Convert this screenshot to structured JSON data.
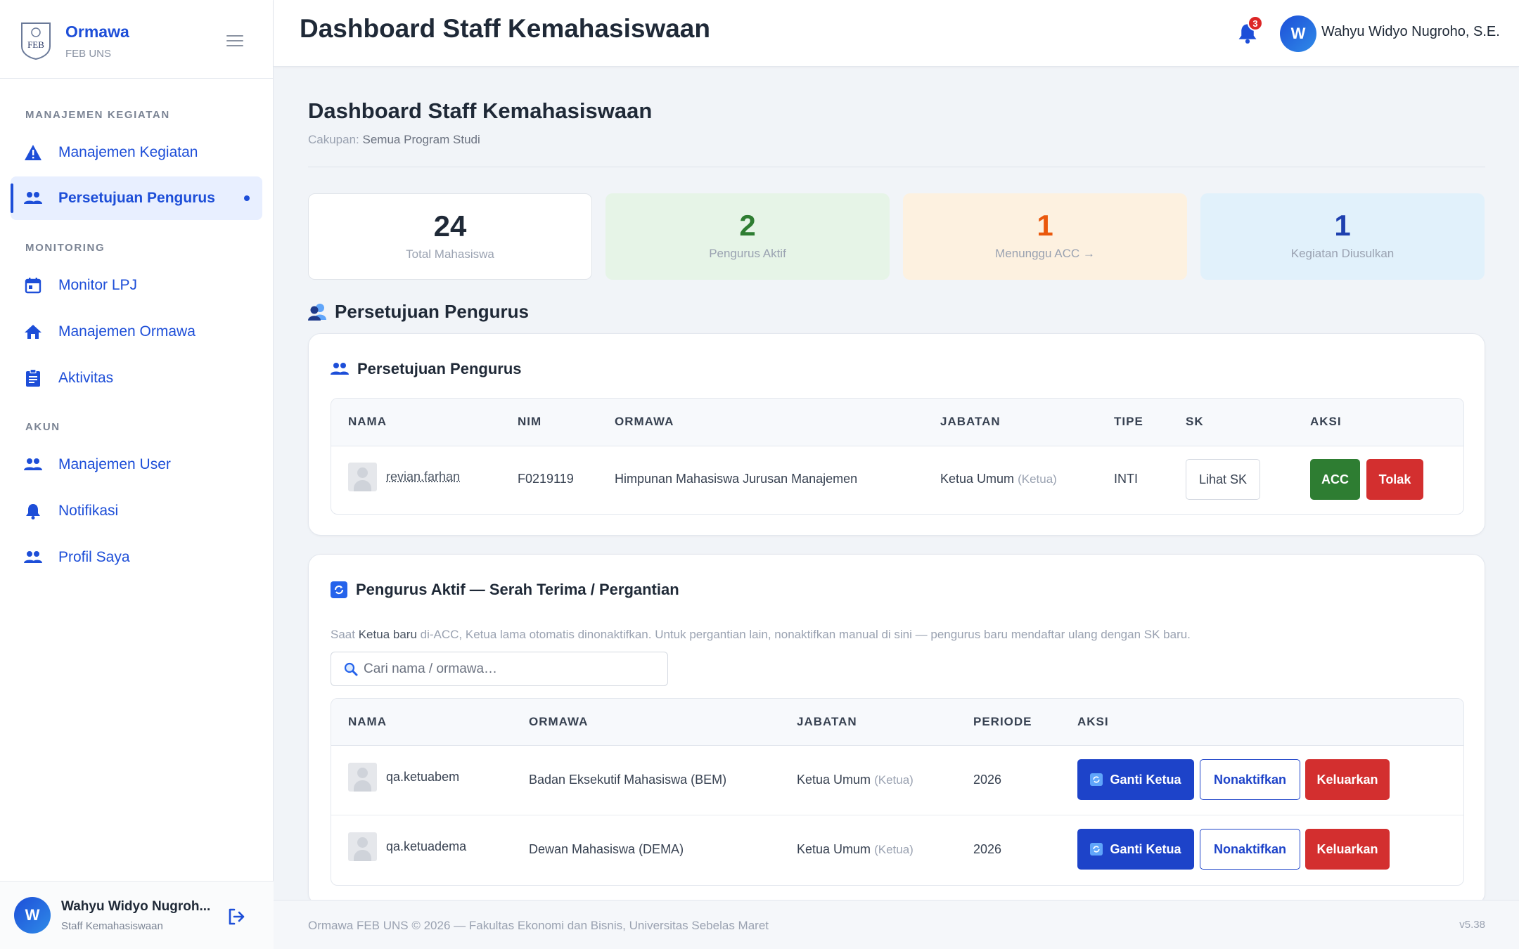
{
  "brand": {
    "logo_text": "FEB",
    "name": "Ormawa",
    "sub": "FEB UNS"
  },
  "sidebar": {
    "sections": [
      {
        "label": "MANAJEMEN KEGIATAN"
      },
      {
        "label": "MONITORING"
      },
      {
        "label": "AKUN"
      }
    ],
    "items": [
      {
        "label": "Manajemen Kegiatan",
        "icon": "warning-icon"
      },
      {
        "label": "Persetujuan Pengurus",
        "icon": "people-icon",
        "active": true
      },
      {
        "label": "Monitor LPJ",
        "icon": "calendar-icon"
      },
      {
        "label": "Manajemen Ormawa",
        "icon": "home-icon"
      },
      {
        "label": "Aktivitas",
        "icon": "clipboard-icon"
      },
      {
        "label": "Manajemen User",
        "icon": "people-icon"
      },
      {
        "label": "Notifikasi",
        "icon": "bell-icon"
      },
      {
        "label": "Profil Saya",
        "icon": "people-icon"
      }
    ],
    "user": {
      "initial": "W",
      "name": "Wahyu Widyo Nugroh...",
      "role": "Staff Kemahasiswaan"
    }
  },
  "topbar": {
    "title": "Dashboard Staff Kemahasiswaan",
    "notif_count": "3",
    "user_initial": "W",
    "user_name": "Wahyu Widyo Nugroho, S.E."
  },
  "page": {
    "title": "Dashboard Staff Kemahasiswaan",
    "scope_label": "Cakupan:",
    "scope_value": "Semua Program Studi"
  },
  "stats": [
    {
      "value": "24",
      "label": "Total Mahasiswa",
      "color": "#1f2937",
      "bg": "#ffffff"
    },
    {
      "value": "2",
      "label": "Pengurus Aktif",
      "color": "#2e7d32",
      "bg": "#e6f4e7"
    },
    {
      "value": "1",
      "label": "Menunggu ACC →",
      "color": "#ea580c",
      "bg": "#fdf1e0"
    },
    {
      "value": "1",
      "label": "Kegiatan Diusulkan",
      "color": "#1e40af",
      "bg": "#e1f1fb"
    }
  ],
  "section_heading": "Persetujuan Pengurus",
  "approval": {
    "title": "Persetujuan Pengurus",
    "columns": [
      "NAMA",
      "NIM",
      "ORMAWA",
      "JABATAN",
      "TIPE",
      "SK",
      "AKSI"
    ],
    "rows": [
      {
        "name": "revian.farhan",
        "nim": "F0219119",
        "ormawa": "Himpunan Mahasiswa Jurusan Manajemen",
        "jabatan": "Ketua Umum",
        "jabatan_note": "(Ketua)",
        "tipe": "INTI",
        "sk_button": "Lihat SK",
        "acc_button": "ACC",
        "reject_button": "Tolak"
      }
    ]
  },
  "active": {
    "title": "Pengurus Aktif — Serah Terima / Pergantian",
    "note_pre": "Saat",
    "note_bold": "Ketua baru",
    "note_post": "di-ACC, Ketua lama otomatis dinonaktifkan. Untuk pergantian lain, nonaktifkan manual di sini — pengurus baru mendaftar ulang dengan SK baru.",
    "search_placeholder": "Cari nama / ormawa…",
    "columns": [
      "NAMA",
      "ORMAWA",
      "JABATAN",
      "PERIODE",
      "AKSI"
    ],
    "rows": [
      {
        "name": "qa.ketuabem",
        "ormawa": "Badan Eksekutif Mahasiswa (BEM)",
        "jabatan": "Ketua Umum",
        "jabatan_note": "(Ketua)",
        "periode": "2026",
        "btn_ganti": "Ganti Ketua",
        "btn_nonaktif": "Nonaktifkan",
        "btn_keluar": "Keluarkan"
      },
      {
        "name": "qa.ketuadema",
        "ormawa": "Dewan Mahasiswa (DEMA)",
        "jabatan": "Ketua Umum",
        "jabatan_note": "(Ketua)",
        "periode": "2026",
        "btn_ganti": "Ganti Ketua",
        "btn_nonaktif": "Nonaktifkan",
        "btn_keluar": "Keluarkan"
      }
    ]
  },
  "footer": {
    "text": "Ormawa FEB UNS © 2026 — Fakultas Ekonomi dan Bisnis, Universitas Sebelas Maret",
    "version": "v5.38"
  }
}
